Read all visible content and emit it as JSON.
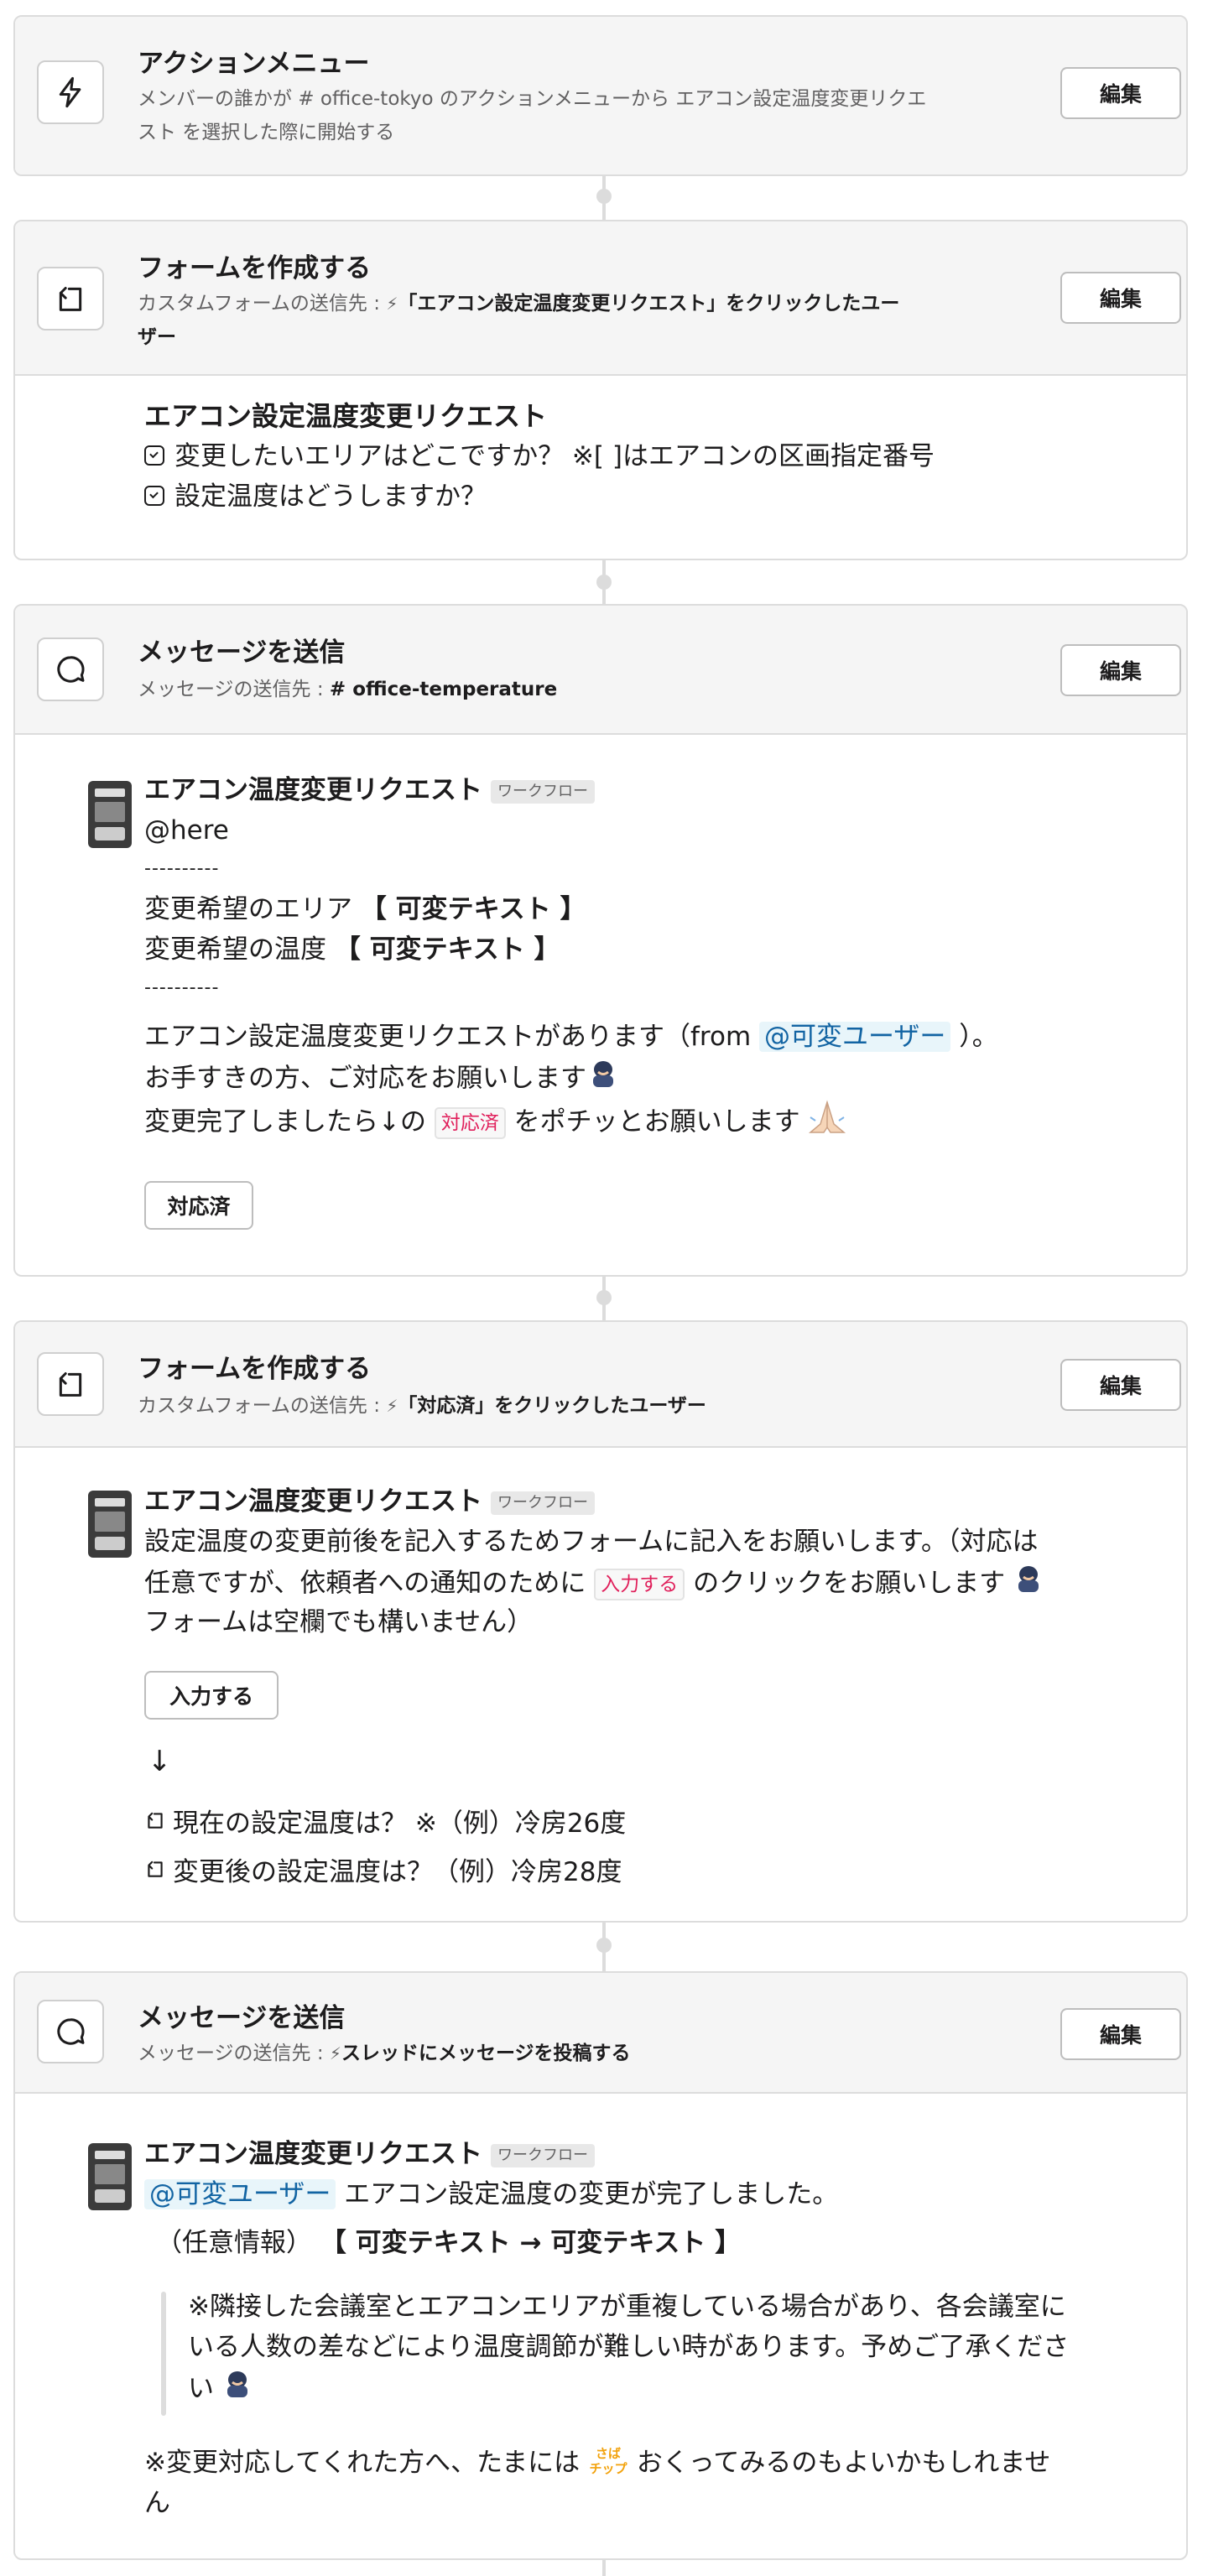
{
  "steps": [
    {
      "title": "アクションメニュー",
      "subtitle_line1": "メンバーの誰かが # office-tokyo のアクションメニューから エアコン設定温度変更リクエ",
      "subtitle_line2": "スト を選択した際に開始する",
      "edit_label": "編集",
      "icon": "lightning-icon"
    },
    {
      "title": "フォームを作成する",
      "subtitle_prefix": "カスタムフォームの送信先 : ",
      "subtitle_bold_line1": "「エアコン設定温度変更リクエスト」をクリックしたユー",
      "subtitle_bold_line2": "ザー",
      "edit_label": "編集",
      "icon": "form-icon",
      "form_title": "エアコン設定温度変更リクエスト",
      "fields": [
        "変更したいエリアはどこですか？ ※[ ]はエアコンの区画指定番号",
        "設定温度はどうしますか？"
      ]
    },
    {
      "title": "メッセージを送信",
      "subtitle_prefix": "メッセージの送信先 : ",
      "subtitle_bold": "# office-temperature",
      "edit_label": "編集",
      "icon": "message-icon",
      "msg": {
        "sender": "エアコン温度変更リクエスト",
        "badge": "ワークフロー",
        "here": "@here",
        "dashes": "----------",
        "area_label": "変更希望のエリア ",
        "area_value": "【 可変テキスト 】",
        "temp_label": "変更希望の温度 ",
        "temp_value": "【 可変テキスト 】",
        "line_req_a": "エアコン設定温度変更リクエストがあります（from ",
        "line_req_mention": "@可変ユーザー",
        "line_req_b": " ）。",
        "line_please": "お手すきの方、ご対応をお願いします",
        "line_done_a": "変更完了しましたら↓の ",
        "line_done_code": "対応済",
        "line_done_b": " をポチッとお願いします",
        "button": "対応済"
      }
    },
    {
      "title": "フォームを作成する",
      "subtitle_prefix": "カスタムフォームの送信先 : ",
      "subtitle_bold": "「対応済」をクリックしたユーザー",
      "edit_label": "編集",
      "icon": "form-icon",
      "msg": {
        "sender": "エアコン温度変更リクエスト",
        "badge": "ワークフロー",
        "line1": "設定温度の変更前後を記入するためフォームに記入をお願いします。（対応は",
        "line2_a": "任意ですが、依頼者への通知のために ",
        "line2_code": "入力する",
        "line2_b": " のクリックをお願いします",
        "line3": "フォームは空欄でも構いません）",
        "button": "入力する",
        "arrow": "↓",
        "fields": [
          "現在の設定温度は？ ※（例）冷房26度",
          "変更後の設定温度は？（例）冷房28度"
        ]
      }
    },
    {
      "title": "メッセージを送信",
      "subtitle_prefix": "メッセージの送信先 : ",
      "subtitle_bold": "スレッドにメッセージを投稿する",
      "edit_label": "編集",
      "icon": "message-icon",
      "msg": {
        "sender": "エアコン温度変更リクエスト",
        "badge": "ワークフロー",
        "mention": "@可変ユーザー",
        "line1": " エアコン設定温度の変更が完了しました。",
        "optional_label": "（任意情報） ",
        "optional_value": "【 可変テキスト → 可変テキスト 】",
        "quote1": "※隣接した会議室とエアコンエリアが重複している場合があり、各会議室に",
        "quote2": "いる人数の差などにより温度調節が難しい時があります。予めご了承くださ",
        "quote3": "い",
        "footer1_a": "※変更対応してくれた方へ、たまには ",
        "footer1_emoji": "さば\nチップ",
        "footer1_b": " おくってみるのもよいかもしれませ",
        "footer2": "ん"
      }
    }
  ]
}
